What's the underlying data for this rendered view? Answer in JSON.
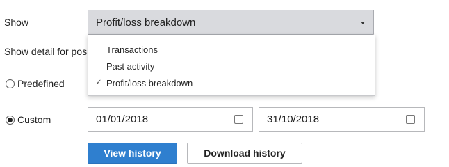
{
  "form": {
    "show_label": "Show",
    "show_detail_label": "Show detail for posi",
    "select": {
      "selected_value": "Profit/loss breakdown"
    },
    "dropdown_options": [
      {
        "label": "Transactions",
        "checked": false
      },
      {
        "label": "Past activity",
        "checked": false
      },
      {
        "label": "Profit/loss breakdown",
        "checked": true
      }
    ],
    "check_mark": "✓",
    "radio_predefined": {
      "label": "Predefined",
      "selected": false
    },
    "radio_custom": {
      "label": "Custom",
      "selected": true
    },
    "date_from": "01/01/2018",
    "date_to": "31/10/2018",
    "view_history_label": "View history",
    "download_history_label": "Download history"
  },
  "colors": {
    "primary_button": "#2f7fcf",
    "select_background": "#d9dade"
  }
}
